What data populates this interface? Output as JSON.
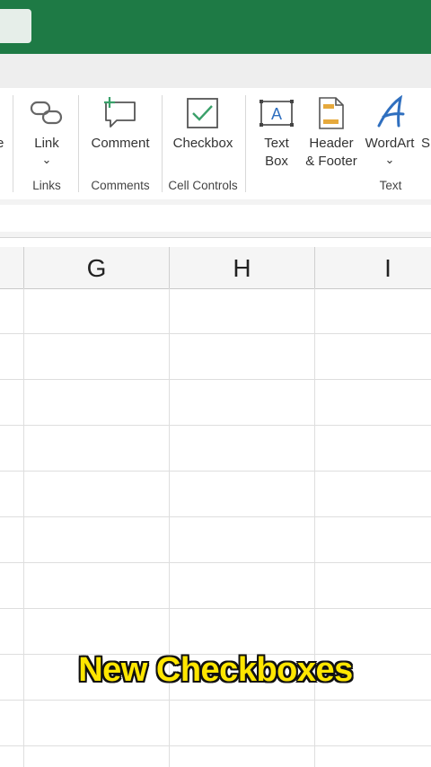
{
  "ribbon": {
    "partial_left_label": "e",
    "link": {
      "label": "Link",
      "dropdown": "⌄"
    },
    "comment": {
      "label": "Comment"
    },
    "checkbox": {
      "label": "Checkbox"
    },
    "textbox": {
      "label_line1": "Text",
      "label_line2": "Box"
    },
    "header_footer": {
      "label_line1": "Header",
      "label_line2": "& Footer"
    },
    "wordart": {
      "label": "WordArt",
      "dropdown": "⌄"
    },
    "partial_right_label": "Si",
    "groups": {
      "links": "Links",
      "comments": "Comments",
      "cell_controls": "Cell Controls",
      "text": "Text"
    }
  },
  "sheet": {
    "columns": [
      "G",
      "H",
      "I"
    ]
  },
  "caption": "New Checkboxes",
  "colors": {
    "titlebar": "#1e7a45",
    "caption": "#ffe600",
    "icon_blue": "#2f6fbf",
    "icon_green": "#3aa06a"
  }
}
